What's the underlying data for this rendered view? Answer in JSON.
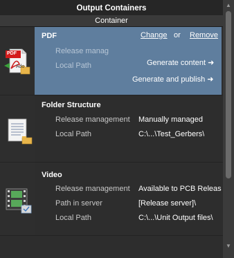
{
  "header": {
    "title": "Output Containers",
    "subtitle": "Container"
  },
  "pdf": {
    "title": "PDF",
    "change_link": "Change",
    "or_text": "or",
    "remove_link": "Remove",
    "release_label": "Release manag",
    "local_path_label": "Local Path",
    "generate_content": "Generate content",
    "generate_publish": "Generate and publish",
    "arrow": "➜",
    "icon_badge": "PDF",
    "icon_text": "Ado"
  },
  "folder": {
    "title": "Folder Structure",
    "release_label": "Release management",
    "release_value": "Manually managed",
    "local_path_label": "Local Path",
    "local_path_value": "C:\\...\\Test_Gerbers\\"
  },
  "video": {
    "title": "Video",
    "release_label": "Release management",
    "release_value": "Available to PCB Releas",
    "server_label": "Path in server",
    "server_value": "[Release server]\\",
    "local_path_label": "Local Path",
    "local_path_value": "C:\\...\\Unit Output files\\"
  },
  "colors": {
    "selected_row": "#5f7e9e",
    "panel_bg": "#2d2d2d",
    "header_bg": "#262626"
  },
  "icons": [
    "pdf-document-icon",
    "text-document-icon",
    "video-film-icon",
    "folder-icon",
    "arrow-right-icon",
    "scroll-up-icon",
    "scroll-down-icon"
  ]
}
